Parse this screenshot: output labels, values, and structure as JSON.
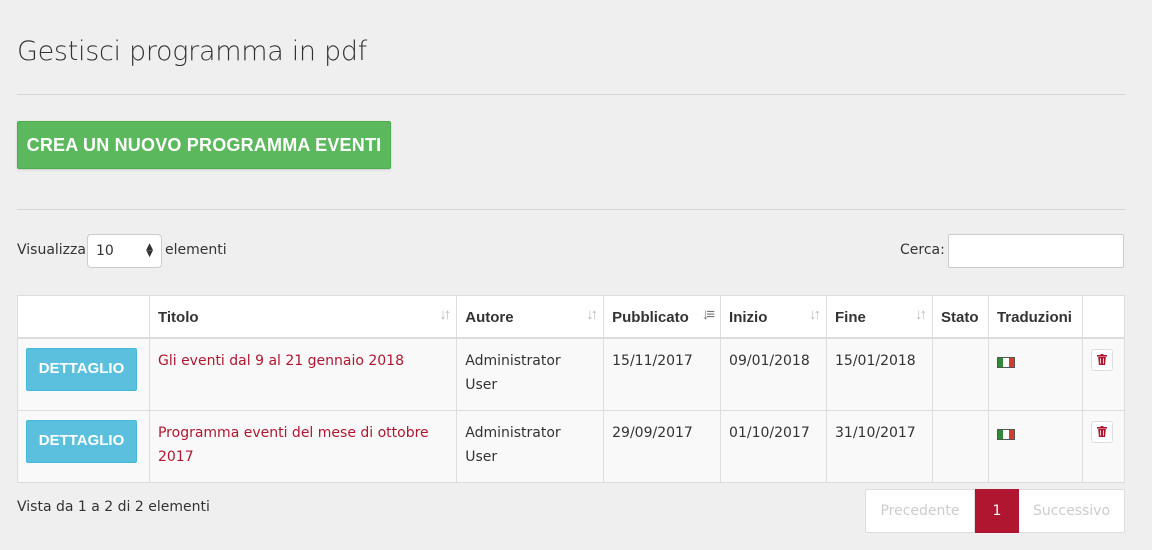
{
  "page": {
    "title": "Gestisci programma in pdf"
  },
  "actions": {
    "create_label": "CREA UN NUOVO PROGRAMMA EVENTI"
  },
  "length": {
    "prefix": "Visualizza",
    "value": "10",
    "suffix": "elementi"
  },
  "search": {
    "label": "Cerca:",
    "value": "",
    "placeholder": ""
  },
  "table": {
    "columns": [
      "",
      "Titolo",
      "Autore",
      "Pubblicato",
      "Inizio",
      "Fine",
      "Stato",
      "Traduzioni",
      ""
    ],
    "rows": [
      {
        "button": "DETTAGLIO",
        "titolo": "Gli eventi dal 9 al 21 gennaio 2018",
        "autore": "Administrator User",
        "pubblicato": "15/11/2017",
        "inizio": "09/01/2018",
        "fine": "15/01/2018",
        "stato": "",
        "traduzioni_icon": "italy-flag-icon"
      },
      {
        "button": "DETTAGLIO",
        "titolo": "Programma eventi del mese di ottobre 2017",
        "autore": "Administrator User",
        "pubblicato": "29/09/2017",
        "inizio": "01/10/2017",
        "fine": "31/10/2017",
        "stato": "",
        "traduzioni_icon": "italy-flag-icon"
      }
    ]
  },
  "footer": {
    "info": "Vista da 1 a 2 di 2 elementi"
  },
  "pagination": {
    "prev": "Precedente",
    "current": "1",
    "next": "Successivo"
  },
  "colors": {
    "accent": "#b0162f",
    "success": "#5cb85c",
    "info": "#5bc0de"
  }
}
